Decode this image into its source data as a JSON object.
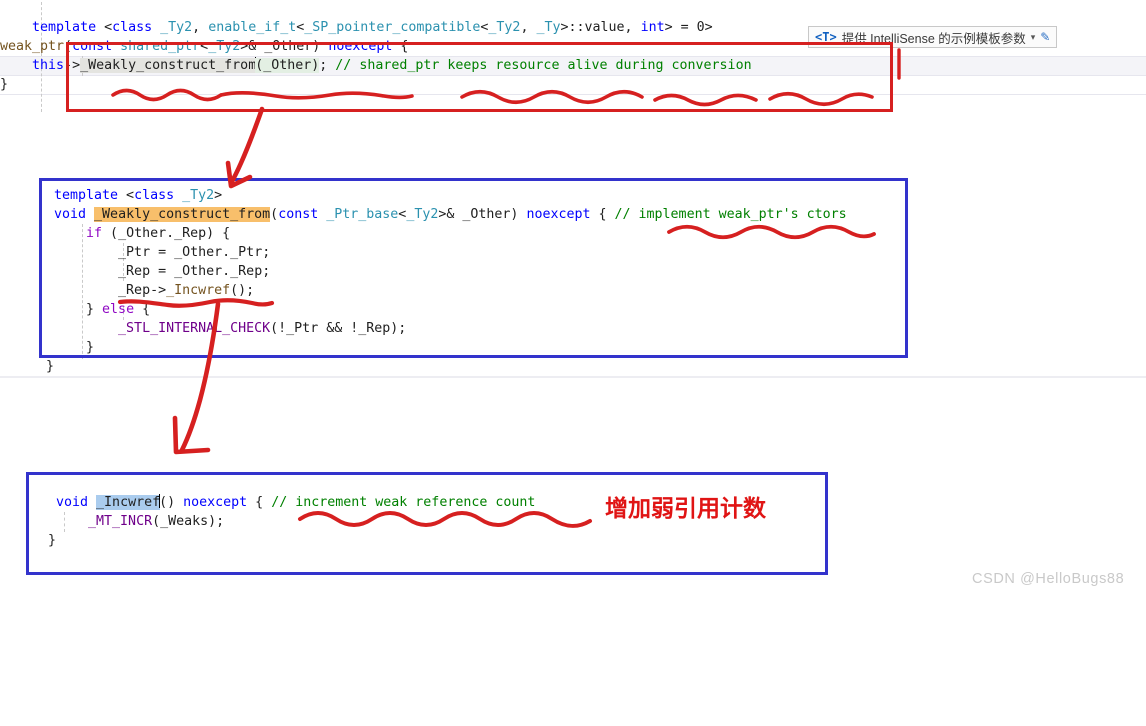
{
  "watermark": "CSDN @HelloBugs88",
  "intellisense": {
    "tparam": "<T>",
    "label": "提供 IntelliSense 的示例模板参数",
    "dropdown_glyph": "▾",
    "edit_glyph": "✎"
  },
  "annotation_cn": "增加弱引用计数",
  "colors": {
    "red_box": "#d62020",
    "blue_box": "#3333cc",
    "ink_red": "#d62020",
    "highlight_orange": "#f8bf6b",
    "highlight_blue": "#aaccee",
    "comment_green": "#008000",
    "keyword_blue": "#0000ff",
    "type_teal": "#2b91af",
    "macro_purple": "#6f008a",
    "watermark_grey": "#c9c9c9"
  },
  "block_top": {
    "lines": [
      {
        "id": "t1",
        "text": "    template <class _Ty2, enable_if_t<_SP_pointer_compatible<_Ty2, _Ty>::value, int> = 0>"
      },
      {
        "id": "t2",
        "text": "weak_ptr(const shared_ptr<_Ty2>& _Other) noexcept {"
      },
      {
        "id": "t3",
        "text": "    this->_Weakly_construct_from(_Other); // shared_ptr keeps resource alive during conversion"
      },
      {
        "id": "t4",
        "text": "}"
      }
    ]
  },
  "block_mid": {
    "lines": [
      {
        "id": "m1",
        "text": "template <class _Ty2>"
      },
      {
        "id": "m2",
        "text": "void _Weakly_construct_from(const _Ptr_base<_Ty2>& _Other) noexcept { // implement weak_ptr's ctors"
      },
      {
        "id": "m3",
        "text": "    if (_Other._Rep) {"
      },
      {
        "id": "m4",
        "text": "        _Ptr = _Other._Ptr;"
      },
      {
        "id": "m5",
        "text": "        _Rep = _Other._Rep;"
      },
      {
        "id": "m6",
        "text": "        _Rep->_Incwref();"
      },
      {
        "id": "m7",
        "text": "    } else {"
      },
      {
        "id": "m8",
        "text": "        _STL_INTERNAL_CHECK(!_Ptr && !_Rep);"
      },
      {
        "id": "m9",
        "text": "    }"
      },
      {
        "id": "m10",
        "text": "}"
      }
    ]
  },
  "block_bottom": {
    "lines": [
      {
        "id": "b1",
        "text": "void _Incwref() noexcept { // increment weak reference count"
      },
      {
        "id": "b2",
        "text": "    _MT_INCR(_Weaks);"
      },
      {
        "id": "b3",
        "text": "}"
      }
    ]
  },
  "tokens": {
    "template": "template",
    "class": "class",
    "ty2": "_Ty2",
    "enable_if_t": "enable_if_t",
    "sp_pointer_compatible": "_SP_pointer_compatible",
    "ty": "_Ty",
    "value": "value",
    "int": "int",
    "zero": "0",
    "weak_ptr": "weak_ptr",
    "const": "const",
    "shared_ptr": "shared_ptr",
    "other": "_Other",
    "noexcept": "noexcept",
    "this": "this",
    "weakly_construct_from": "_Weakly_construct_from",
    "comment_top": "// shared_ptr keeps resource alive during conversion",
    "void": "void",
    "ptr_base": "_Ptr_base",
    "comment_mid": "// implement weak_ptr's ctors",
    "if": "if",
    "else": "else",
    "rep": "_Rep",
    "ptr": "_Ptr",
    "incwref": "_Incwref",
    "stl_internal_check": "_STL_INTERNAL_CHECK",
    "mt_incr": "_MT_INCR",
    "weaks": "_Weaks",
    "comment_bottom": "// increment weak reference count"
  }
}
